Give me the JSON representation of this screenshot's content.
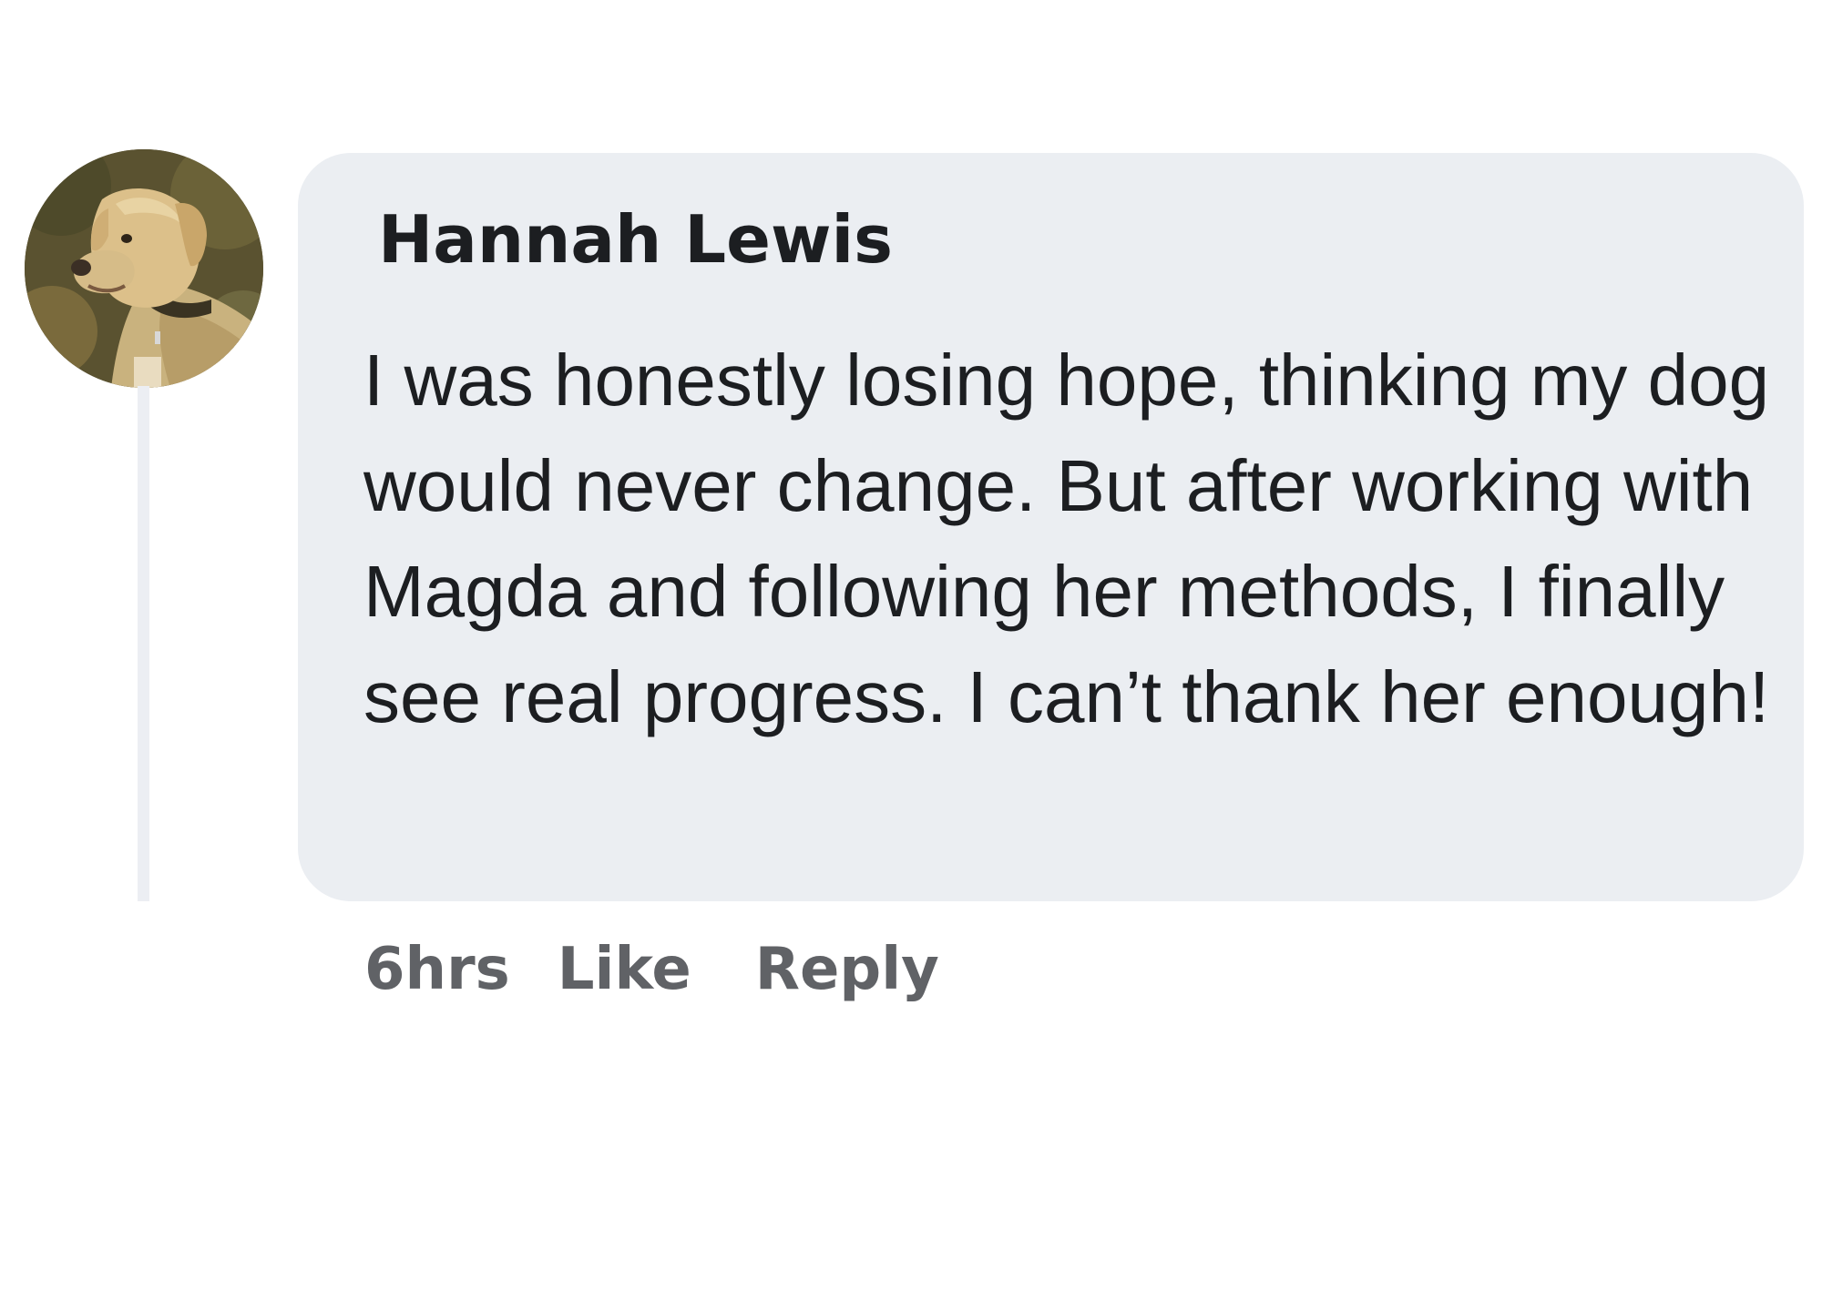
{
  "comment": {
    "author": "Hannah Lewis",
    "avatar_icon": "dog-avatar",
    "text": "I was honestly losing hope, thinking my dog would never change. But after working with Magda and following her methods, I finally see real progress. I can’t thank her enough!",
    "timestamp": "6hrs",
    "like_label": "Like",
    "reply_label": "Reply"
  },
  "colors": {
    "bubble_background": "#ebeef2",
    "text": "#1c1e21",
    "action_text": "#606266",
    "thread_line": "#eceef3"
  }
}
